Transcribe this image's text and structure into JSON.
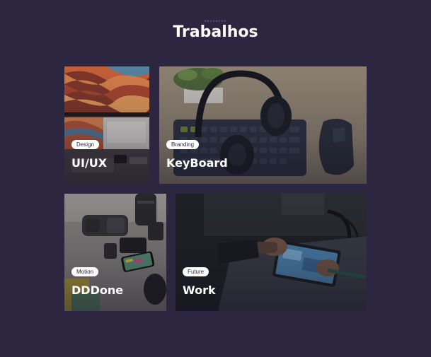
{
  "section": {
    "eyebrow": "RECENTES",
    "title": "Trabalhos"
  },
  "cards": [
    {
      "tag": "Design",
      "title": "UI/UX"
    },
    {
      "tag": "Branding",
      "title": "KeyBoard"
    },
    {
      "tag": "Motion",
      "title": "DDDone"
    },
    {
      "tag": "Future",
      "title": "Work"
    }
  ],
  "colors": {
    "background": "#2c2640",
    "tag_background": "#ffffff",
    "title_text": "#ffffff"
  }
}
